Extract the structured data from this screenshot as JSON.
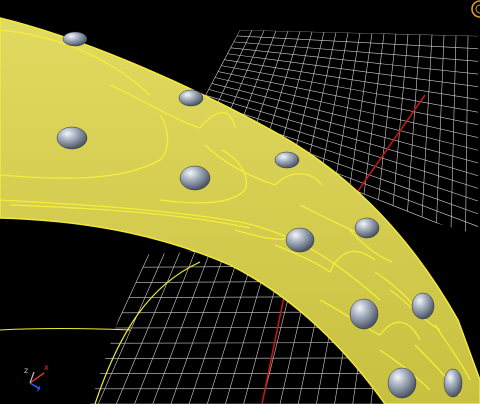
{
  "viewport": {
    "background_color": "#000000",
    "grid_color": "#cfcfcf",
    "grid_axis_color": "#c01818",
    "model_fill_color": "#d8d252",
    "model_edge_color": "#f2ea3c",
    "gem_color": "#8e9aa8"
  },
  "axis_triad": {
    "x_label": "x",
    "y_label": "y",
    "z_label": "z",
    "x_color": "#e03030",
    "y_color": "#3060ff",
    "z_color": "#c0c0c0"
  },
  "corner_widget": {
    "icon": "view-cube-icon",
    "color": "#e0a020"
  }
}
